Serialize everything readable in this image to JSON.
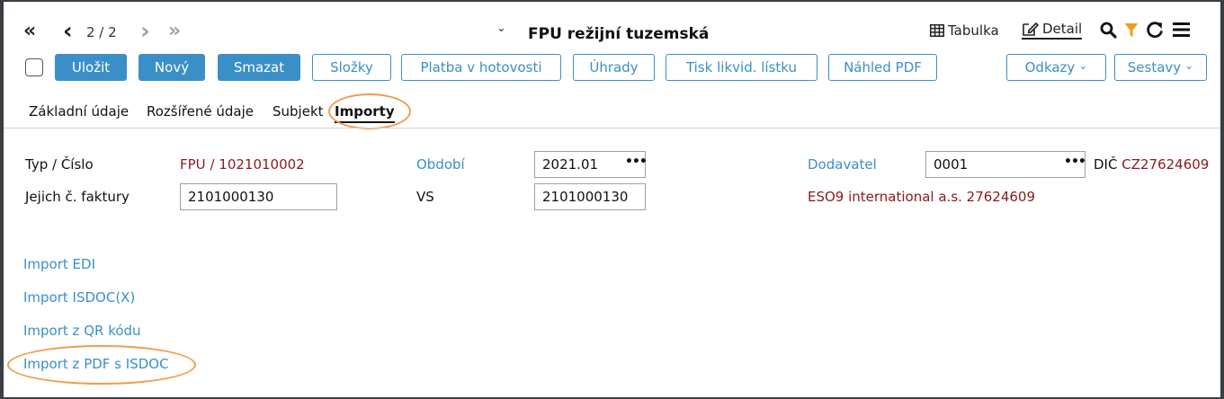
{
  "navigation": {
    "first": "«",
    "prev": "‹",
    "pager": "2 / 2",
    "next": "›",
    "last": "»"
  },
  "header": {
    "title_caret": "⌄",
    "title": "FPU režijní tuzemská"
  },
  "view_controls": {
    "table_label": "Tabulka",
    "detail_label": "Detail"
  },
  "toolbar": {
    "save": "Uložit",
    "new": "Nový",
    "delete": "Smazat",
    "folders": "Složky",
    "cash_payment": "Platba v hotovosti",
    "payments": "Úhrady",
    "print_slip": "Tisk likvid. lístku",
    "pdf_preview": "Náhled PDF",
    "links": "Odkazy",
    "reports": "Sestavy",
    "dropdown_caret": "⌄"
  },
  "tabs": [
    "Základní údaje",
    "Rozšířené údaje",
    "Subjekt",
    "Importy"
  ],
  "form": {
    "type_number_label": "Typ / Číslo",
    "type_value": "FPU",
    "type_sep": "/",
    "number_value": "1021010002",
    "their_invoice_label": "Jejich č. faktury",
    "their_invoice_value": "2101000130",
    "period_label": "Období",
    "period_value": "2021.01",
    "vs_label": "VS",
    "vs_value": "2101000130",
    "supplier_label": "Dodavatel",
    "supplier_value": "0001",
    "dic_label": "DIČ",
    "dic_value": "CZ27624609",
    "supplier_name": "ESO9 international a.s. 27624609",
    "lookup_glyph": "•••"
  },
  "imports": [
    "Import EDI",
    "Import ISDOC(X)",
    "Import z QR kódu",
    "Import z PDF s ISDOC"
  ],
  "colors": {
    "accent": "#3a8fc6",
    "value": "#8b1a1a",
    "highlight": "#f39a4a",
    "filter": "#f39a1a"
  }
}
